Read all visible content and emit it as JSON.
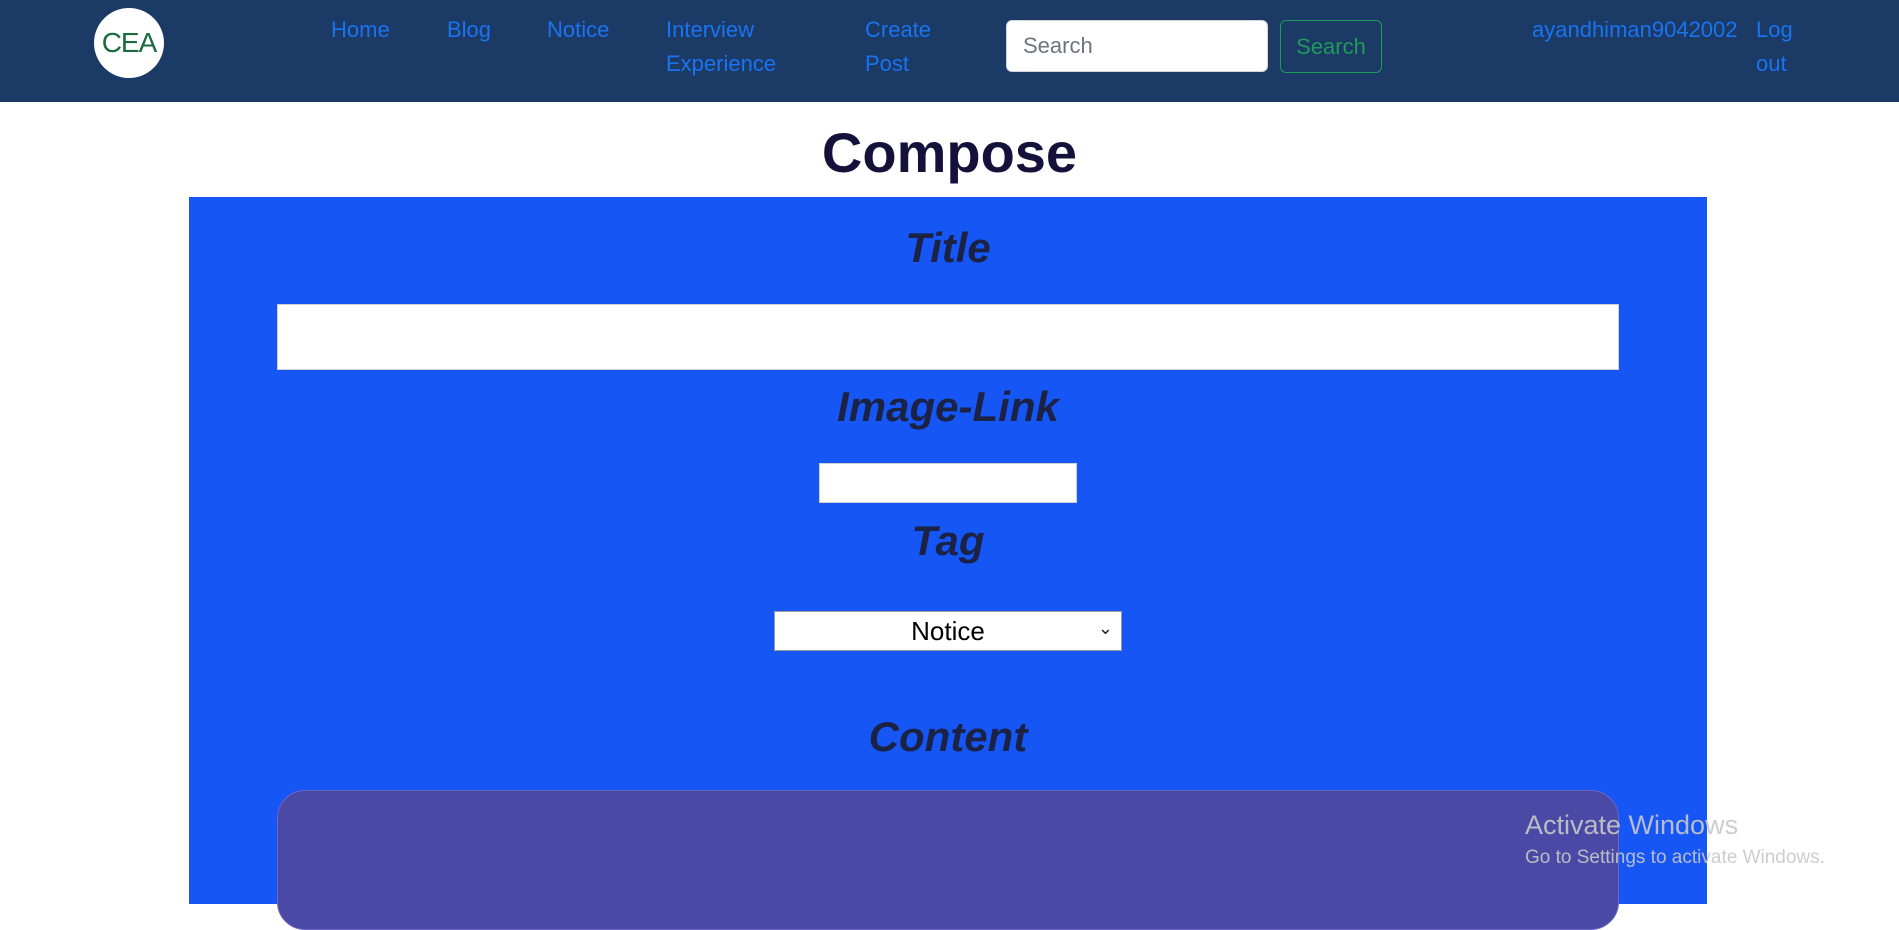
{
  "nav": {
    "logo_text": "CEA",
    "links": [
      {
        "label": "Home"
      },
      {
        "label": "Blog"
      },
      {
        "label": "Notice"
      },
      {
        "label_line1": "Interview",
        "label_line2": "Experience"
      },
      {
        "label_line1": "Create",
        "label_line2": "Post"
      }
    ],
    "search": {
      "placeholder": "Search",
      "button_label": "Search"
    },
    "username": "ayandhiman9042002",
    "logout_line1": "Log",
    "logout_line2": "out"
  },
  "page": {
    "title": "Compose"
  },
  "form": {
    "title_label": "Title",
    "title_value": "",
    "image_label": "Image-Link",
    "image_value": "",
    "tag_label": "Tag",
    "tag_selected": "Notice",
    "content_label": "Content"
  },
  "watermark": {
    "line1": "Activate Windows",
    "line2": "Go to Settings to activate Windows."
  },
  "colors": {
    "navbar_bg": "#1c3a66",
    "link": "#1a73f0",
    "panel_bg": "#1656f5",
    "content_bg": "#4a4aa6",
    "search_button": "#1f9a5a"
  }
}
